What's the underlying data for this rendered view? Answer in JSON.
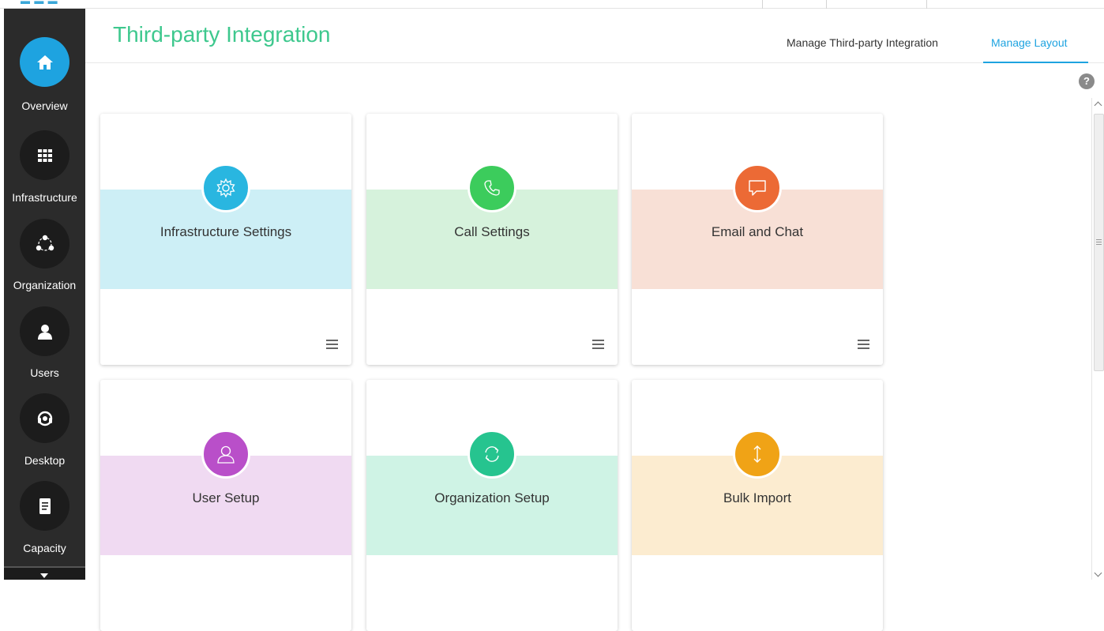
{
  "colors": {
    "accent": "#1ea3e0",
    "title_green": "#3ec88e",
    "sidebar_bg": "#2b2b2b"
  },
  "header": {
    "title": "Third-party Integration",
    "tabs": [
      {
        "label": "Manage Third-party Integration",
        "active": false
      },
      {
        "label": "Manage Layout",
        "active": true
      }
    ],
    "help": "?"
  },
  "sidebar": {
    "items": [
      {
        "label": "Overview",
        "icon": "home-icon",
        "active": true
      },
      {
        "label": "Infrastructure",
        "icon": "grid-icon",
        "active": false
      },
      {
        "label": "Organization",
        "icon": "organization-icon",
        "active": false
      },
      {
        "label": "Users",
        "icon": "user-icon",
        "active": false
      },
      {
        "label": "Desktop",
        "icon": "headset-icon",
        "active": false
      },
      {
        "label": "Capacity",
        "icon": "document-icon",
        "active": false
      }
    ]
  },
  "cards": [
    {
      "title": "Infrastructure Settings",
      "icon": "gear-icon",
      "icon_color": "#29b6e0",
      "band_color": "#cdeff6"
    },
    {
      "title": "Call Settings",
      "icon": "phone-icon",
      "icon_color": "#3ccc5c",
      "band_color": "#d6f2dc"
    },
    {
      "title": "Email and Chat",
      "icon": "chat-icon",
      "icon_color": "#ec6a35",
      "band_color": "#f8e0d6"
    },
    {
      "title": "User Setup",
      "icon": "user-icon",
      "icon_color": "#b94fc9",
      "band_color": "#f0daf2"
    },
    {
      "title": "Organization Setup",
      "icon": "sync-icon",
      "icon_color": "#26c48f",
      "band_color": "#cff3e5"
    },
    {
      "title": "Bulk Import",
      "icon": "import-icon",
      "icon_color": "#f0a316",
      "band_color": "#fcecd0"
    }
  ]
}
